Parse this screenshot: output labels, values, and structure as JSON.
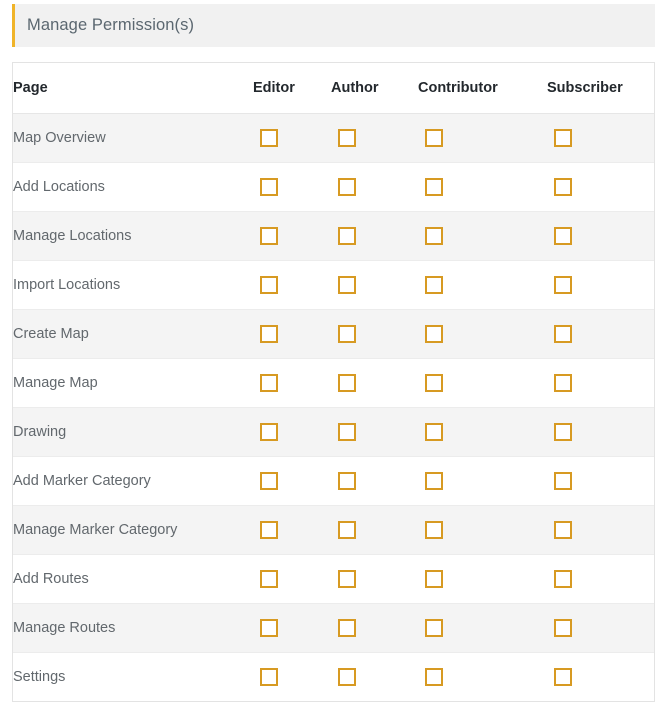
{
  "panel": {
    "title": "Manage Permission(s)",
    "accent_color": "#f0b429",
    "header_bg": "#f1f1f1"
  },
  "table": {
    "columns": [
      {
        "key": "page",
        "label": "Page"
      },
      {
        "key": "editor",
        "label": "Editor"
      },
      {
        "key": "author",
        "label": "Author"
      },
      {
        "key": "contributor",
        "label": "Contributor"
      },
      {
        "key": "subscriber",
        "label": "Subscriber"
      }
    ],
    "checkbox_border_color": "#d79a22",
    "row_stripe_color": "#f4f4f4",
    "rows": [
      {
        "page": "Map Overview",
        "editor": false,
        "author": false,
        "contributor": false,
        "subscriber": false
      },
      {
        "page": "Add Locations",
        "editor": false,
        "author": false,
        "contributor": false,
        "subscriber": false
      },
      {
        "page": "Manage Locations",
        "editor": false,
        "author": false,
        "contributor": false,
        "subscriber": false
      },
      {
        "page": "Import Locations",
        "editor": false,
        "author": false,
        "contributor": false,
        "subscriber": false
      },
      {
        "page": "Create Map",
        "editor": false,
        "author": false,
        "contributor": false,
        "subscriber": false
      },
      {
        "page": "Manage Map",
        "editor": false,
        "author": false,
        "contributor": false,
        "subscriber": false
      },
      {
        "page": "Drawing",
        "editor": false,
        "author": false,
        "contributor": false,
        "subscriber": false
      },
      {
        "page": "Add Marker Category",
        "editor": false,
        "author": false,
        "contributor": false,
        "subscriber": false
      },
      {
        "page": "Manage Marker Category",
        "editor": false,
        "author": false,
        "contributor": false,
        "subscriber": false
      },
      {
        "page": "Add Routes",
        "editor": false,
        "author": false,
        "contributor": false,
        "subscriber": false
      },
      {
        "page": "Manage Routes",
        "editor": false,
        "author": false,
        "contributor": false,
        "subscriber": false
      },
      {
        "page": "Settings",
        "editor": false,
        "author": false,
        "contributor": false,
        "subscriber": false
      }
    ]
  }
}
